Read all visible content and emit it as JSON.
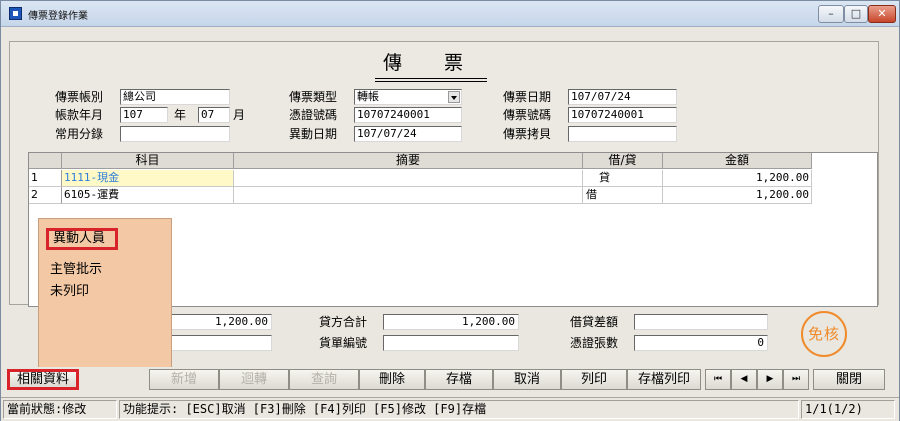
{
  "window": {
    "title": "傳票登錄作業"
  },
  "header": {
    "main_title": "傳 票",
    "voucher_account_label": "傳票帳別",
    "voucher_account_value": "總公司",
    "period_label": "帳款年月",
    "period_year": "107",
    "period_year_unit": "年",
    "period_month": "07",
    "period_month_unit": "月",
    "common_entry_label": "常用分錄",
    "common_entry_value": "",
    "voucher_type_label": "傳票類型",
    "voucher_type_value": "轉帳",
    "cert_no_label": "憑證號碼",
    "cert_no_value": "10707240001",
    "change_date_label": "異動日期",
    "change_date_value": "107/07/24",
    "voucher_date_label": "傳票日期",
    "voucher_date_value": "107/07/24",
    "voucher_no_label": "傳票號碼",
    "voucher_no_value": "10707240001",
    "voucher_copy_label": "傳票拷貝",
    "voucher_copy_value": ""
  },
  "grid": {
    "columns": [
      "科目",
      "摘要",
      "借/貸",
      "金額"
    ],
    "rows": [
      {
        "no": "1",
        "account": "1111-現金",
        "summary": "",
        "dc": "貸",
        "amount": "1,200.00"
      },
      {
        "no": "2",
        "account": "6105-運費",
        "summary": "",
        "dc": "借",
        "amount": "1,200.00"
      }
    ]
  },
  "popup": {
    "items": [
      "異動人員",
      "主管批示",
      "未列印"
    ]
  },
  "totals": {
    "debit_total_value": "1,200.00",
    "credit_total_label": "貸方合計",
    "credit_total_value": "1,200.00",
    "diff_label": "借貸差額",
    "diff_value": "",
    "bill_no_label": "貨單編號",
    "bill_no_value": "",
    "cert_count_label": "憑證張數",
    "cert_count_value": "0",
    "left_field_value": ""
  },
  "stamp": {
    "text": "免核"
  },
  "toolbar": {
    "related": "相關資料",
    "add": "新增",
    "reverse": "迴轉",
    "query": "查詢",
    "delete": "刪除",
    "save": "存檔",
    "cancel": "取消",
    "print": "列印",
    "save_print": "存檔列印",
    "first": "⏮",
    "prev": "◀",
    "next": "▶",
    "last": "⏭",
    "close": "關閉"
  },
  "status": {
    "state": "當前狀態:修改",
    "hint": "功能提示: [ESC]取消 [F3]刪除 [F4]列印 [F5]修改 [F9]存檔",
    "page": "1/1(1/2)"
  },
  "colors": {
    "accent_red": "#d8232a",
    "stamp_orange": "#f08a2b",
    "popup_bg": "#f3c8a5"
  }
}
